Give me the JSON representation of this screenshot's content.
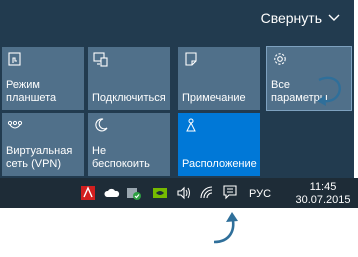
{
  "action_center": {
    "collapse_label": "Свернуть",
    "tiles": [
      {
        "label": "Режим\nпланшета",
        "icon": "tablet-mode-icon"
      },
      {
        "label": "Подключиться",
        "icon": "connect-icon"
      },
      {
        "label": "Примечание",
        "icon": "note-icon"
      },
      {
        "label": "Все\nпараметры",
        "icon": "gear-icon"
      },
      {
        "label": "Виртуальная\nсеть (VPN)",
        "icon": "vpn-icon"
      },
      {
        "label": "Не\nбеспокоить",
        "icon": "moon-icon"
      },
      {
        "label": "Расположение",
        "icon": "location-icon"
      }
    ]
  },
  "taskbar": {
    "language": "РУС",
    "time": "11:45",
    "date": "30.07.2015",
    "tray_icons": [
      "adobe-icon",
      "onedrive-icon",
      "security-icon",
      "nvidia-icon",
      "volume-icon",
      "wifi-icon",
      "action-center-icon"
    ]
  },
  "colors": {
    "panel_bg": "#223b4f",
    "tile_bg": "#50708a",
    "tile_active": "#0078d7",
    "taskbar_bg": "#1e2c37",
    "annotation_arrow": "#2f6f9a"
  }
}
